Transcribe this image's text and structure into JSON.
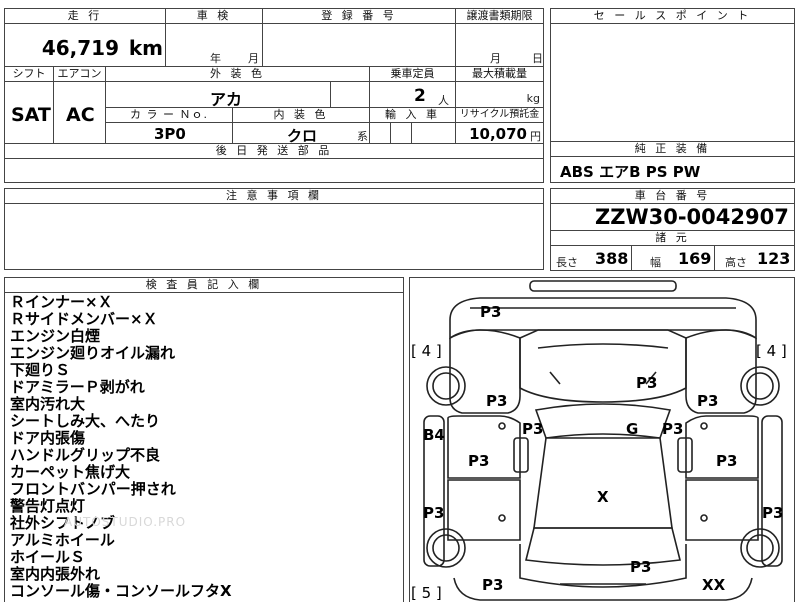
{
  "header": {
    "mileage_label": "走 行",
    "inspection_label": "車 検",
    "registration_label": "登 録 番 号",
    "transfer_label": "譲渡書類期限",
    "selling_point_label": "セ ー ル ス ポ イ ン ト"
  },
  "mileage": {
    "value": "46,719",
    "unit": "km"
  },
  "inspection": {
    "year_unit": "年",
    "month_unit": "月"
  },
  "transfer": {
    "month_unit": "月",
    "day_unit": "日"
  },
  "spec": {
    "shift_label": "シフト",
    "ac_label": "エアコン",
    "exterior_color_label": "外 装 色",
    "capacity_label": "乗車定員",
    "max_load_label": "最大積載量",
    "shift": "SAT",
    "ac": "AC",
    "exterior_color": "アカ",
    "capacity": "2",
    "capacity_unit": "人",
    "load_unit": "kg",
    "color_no_label": "カ ラ ー Ｎｏ.",
    "interior_color_label": "内 装 色",
    "import_label": "輸 入 車",
    "recycle_label": "リサイクル預託金",
    "color_no": "3P0",
    "interior_color": "クロ",
    "interior_suffix": "系",
    "recycle": "10,070",
    "recycle_unit": "円",
    "later_parts_label": "後 日 発 送 部 品"
  },
  "equipment": {
    "label": "純 正 装 備",
    "value": "ABS エアB PS PW"
  },
  "notes_label": "注 意 事 項 欄",
  "chassis": {
    "label": "車 台 番 号",
    "value": "ZZW30-0042907"
  },
  "dimensions": {
    "label": "諸 元",
    "length_label": "長さ",
    "length": "388",
    "width_label": "幅",
    "width": "169",
    "height_label": "高さ",
    "height": "123"
  },
  "inspector": {
    "label": "検 査 員 記 入 欄",
    "remarks": [
      "Ｒインナー×Ｘ",
      "Ｒサイドメンバー×Ｘ",
      "エンジン白煙",
      "エンジン廻りオイル漏れ",
      "下廻りＳ",
      "ドアミラーＰ剥がれ",
      "室内汚れ大",
      "シートしみ大、へたり",
      "ドア内張傷",
      "ハンドルグリップ不良",
      "カーペット焦げ大",
      "フロントバンパー押され",
      "警告灯点灯",
      "社外シフトノブ",
      "アルミホイール",
      "ホイールＳ",
      "室内内張外れ",
      "コンソール傷・コンソールフタX"
    ]
  },
  "diagram": {
    "tire_fl": "[ 4 ]",
    "tire_fr": "[ 4 ]",
    "tire_rl": "[ 5 ]",
    "marks": [
      "P3",
      "P3",
      "P3",
      "P3",
      "P3",
      "G",
      "P3",
      "B4",
      "P3",
      "P3",
      "X",
      "P3",
      "P3",
      "P3",
      "P3",
      "XX"
    ]
  },
  "watermark": "AUTOSTUDIO.PRO"
}
